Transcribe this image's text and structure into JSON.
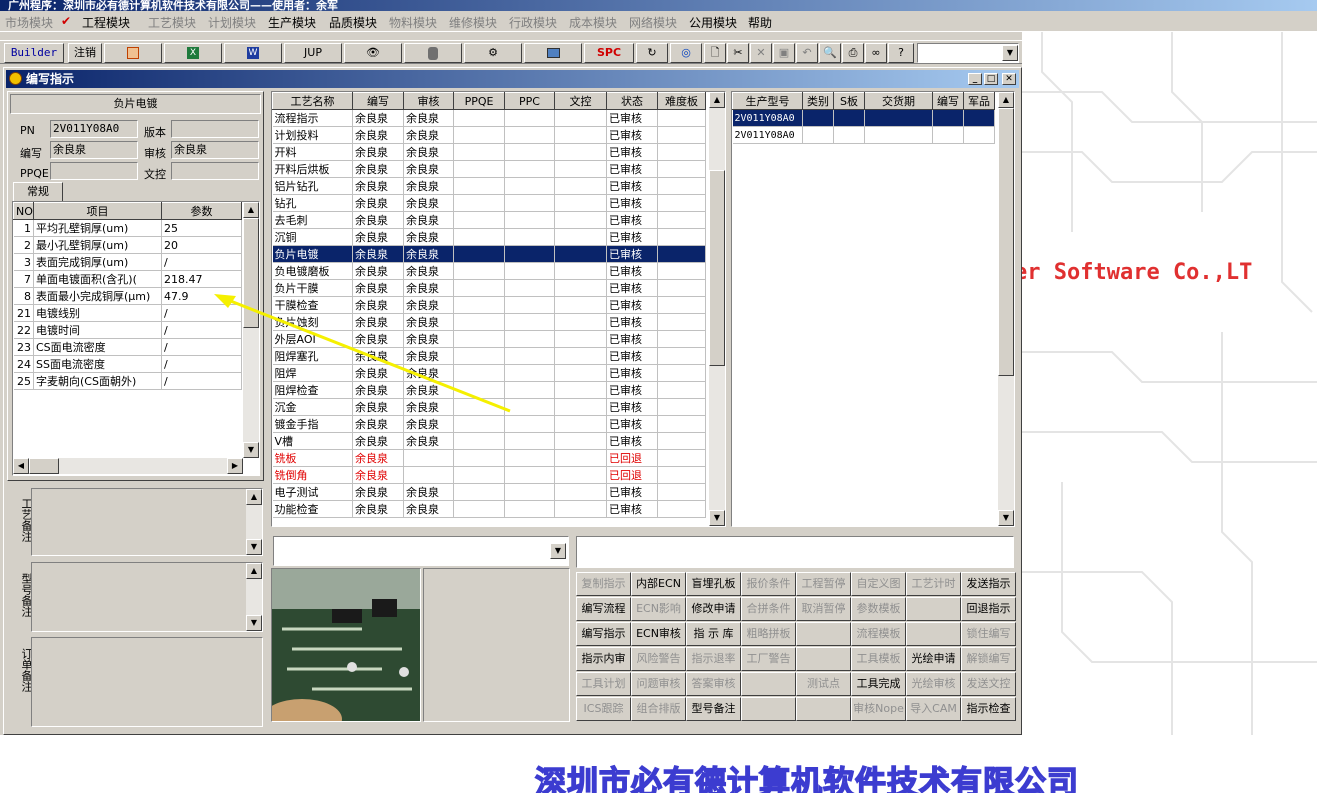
{
  "app_title": "广州程序：深圳市必有德计算机软件技术有限公司——使用者：余军",
  "menu": [
    {
      "label": "市场模块",
      "dim": true
    },
    {
      "label": "工程模块",
      "dim": false,
      "checked": true
    },
    {
      "label": "工艺模块",
      "dim": true
    },
    {
      "label": "计划模块",
      "dim": true
    },
    {
      "label": "生产模块",
      "dim": false
    },
    {
      "label": "品质模块",
      "dim": false
    },
    {
      "label": "物料模块",
      "dim": true
    },
    {
      "label": "维修模块",
      "dim": true
    },
    {
      "label": "行政模块",
      "dim": true
    },
    {
      "label": "成本模块",
      "dim": true
    },
    {
      "label": "网络模块",
      "dim": true
    },
    {
      "label": "公用模块",
      "dim": false
    },
    {
      "label": "帮助",
      "dim": false
    }
  ],
  "toolbar": {
    "builder": "Builder",
    "logout": "注销",
    "jup": "JUP",
    "spc": "SPC"
  },
  "desktop": {
    "watermark_right": "er Software Co.,LT",
    "watermark_bottom": "深圳市必有德计算机软件技术有限公司"
  },
  "window": {
    "title": "编写指示",
    "panel_title": "负片电镀",
    "pn_label": "PN",
    "pn_value": "2V011Y08A0",
    "version_label": "版本",
    "version_value": "",
    "writer_label": "编写",
    "writer_value": "余良泉",
    "review_label": "审核",
    "review_value": "余良泉",
    "ppqe_label": "PPQE",
    "ppqe_value": "",
    "wenkong_label": "文控",
    "wenkong_value": "",
    "tab_normal": "常规",
    "params": {
      "headers": [
        "NO",
        "项目",
        "参数"
      ],
      "rows": [
        [
          "1",
          "平均孔壁铜厚(um)",
          "25"
        ],
        [
          "2",
          "最小孔壁铜厚(um)",
          "20"
        ],
        [
          "3",
          "表面完成铜厚(um)",
          "/"
        ],
        [
          "7",
          "单面电镀面积(含孔)(",
          "218.47"
        ],
        [
          "8",
          "表面最小完成铜厚(μm)",
          "47.9"
        ],
        [
          "21",
          "电镀线别",
          "/"
        ],
        [
          "22",
          "电镀时间",
          "/"
        ],
        [
          "23",
          "CS面电流密度",
          "/"
        ],
        [
          "24",
          "SS面电流密度",
          "/"
        ],
        [
          "25",
          "字麦朝向(CS面朝外)",
          "/"
        ]
      ]
    },
    "notes": {
      "process": "工艺备注",
      "model": "型号备注",
      "order": "订单备注"
    },
    "process": {
      "headers": [
        "工艺名称",
        "编写",
        "审核",
        "PPQE",
        "PPC",
        "文控",
        "状态",
        "难度板"
      ],
      "rows": [
        {
          "name": "流程指示",
          "writer": "余良泉",
          "reviewer": "余良泉",
          "status": "已审核"
        },
        {
          "name": "计划投料",
          "writer": "余良泉",
          "reviewer": "余良泉",
          "status": "已审核"
        },
        {
          "name": "开料",
          "writer": "余良泉",
          "reviewer": "余良泉",
          "status": "已审核"
        },
        {
          "name": "开料后烘板",
          "writer": "余良泉",
          "reviewer": "余良泉",
          "status": "已审核"
        },
        {
          "name": "铝片钻孔",
          "writer": "余良泉",
          "reviewer": "余良泉",
          "status": "已审核"
        },
        {
          "name": "钻孔",
          "writer": "余良泉",
          "reviewer": "余良泉",
          "status": "已审核"
        },
        {
          "name": "去毛刺",
          "writer": "余良泉",
          "reviewer": "余良泉",
          "status": "已审核"
        },
        {
          "name": "沉铜",
          "writer": "余良泉",
          "reviewer": "余良泉",
          "status": "已审核"
        },
        {
          "name": "负片电镀",
          "writer": "余良泉",
          "reviewer": "余良泉",
          "status": "已审核",
          "sel": true
        },
        {
          "name": "负电镀磨板",
          "writer": "余良泉",
          "reviewer": "余良泉",
          "status": "已审核"
        },
        {
          "name": "负片干膜",
          "writer": "余良泉",
          "reviewer": "余良泉",
          "status": "已审核"
        },
        {
          "name": "干膜检查",
          "writer": "余良泉",
          "reviewer": "余良泉",
          "status": "已审核"
        },
        {
          "name": "负片蚀刻",
          "writer": "余良泉",
          "reviewer": "余良泉",
          "status": "已审核"
        },
        {
          "name": "外层AOI",
          "writer": "余良泉",
          "reviewer": "余良泉",
          "status": "已审核"
        },
        {
          "name": "阻焊塞孔",
          "writer": "余良泉",
          "reviewer": "余良泉",
          "status": "已审核"
        },
        {
          "name": "阻焊",
          "writer": "余良泉",
          "reviewer": "余良泉",
          "status": "已审核"
        },
        {
          "name": "阻焊检查",
          "writer": "余良泉",
          "reviewer": "余良泉",
          "status": "已审核"
        },
        {
          "name": "沉金",
          "writer": "余良泉",
          "reviewer": "余良泉",
          "status": "已审核"
        },
        {
          "name": "镀金手指",
          "writer": "余良泉",
          "reviewer": "余良泉",
          "status": "已审核"
        },
        {
          "name": "V槽",
          "writer": "余良泉",
          "reviewer": "余良泉",
          "status": "已审核"
        },
        {
          "name": "铣板",
          "writer": "余良泉",
          "reviewer": "",
          "status": "已回退",
          "red": true
        },
        {
          "name": "铣倒角",
          "writer": "余良泉",
          "reviewer": "",
          "status": "已回退",
          "red": true
        },
        {
          "name": "电子测试",
          "writer": "余良泉",
          "reviewer": "余良泉",
          "status": "已审核"
        },
        {
          "name": "功能检查",
          "writer": "余良泉",
          "reviewer": "余良泉",
          "status": "已审核"
        }
      ]
    },
    "models": {
      "headers": [
        "生产型号",
        "类别",
        "S板",
        "交货期",
        "编写",
        "军品"
      ],
      "rows": [
        [
          "2V011Y08A0",
          "",
          "",
          "",
          "",
          ""
        ],
        [
          "2V011Y08A0",
          "",
          "",
          "",
          "",
          ""
        ]
      ]
    },
    "actions": [
      [
        {
          "t": "复制指示",
          "e": false
        },
        {
          "t": "内部ECN",
          "e": true
        },
        {
          "t": "盲埋孔板",
          "e": true
        },
        {
          "t": "报价条件",
          "e": false
        },
        {
          "t": "工程暂停",
          "e": false
        },
        {
          "t": "自定义图",
          "e": false
        },
        {
          "t": "工艺计时",
          "e": false
        },
        {
          "t": "发送指示",
          "e": true
        }
      ],
      [
        {
          "t": "编写流程",
          "e": true
        },
        {
          "t": "ECN影响",
          "e": false
        },
        {
          "t": "修改申请",
          "e": true
        },
        {
          "t": "合拼条件",
          "e": false
        },
        {
          "t": "取消暂停",
          "e": false
        },
        {
          "t": "参数模板",
          "e": false
        },
        {
          "t": "",
          "e": false
        },
        {
          "t": "回退指示",
          "e": true
        }
      ],
      [
        {
          "t": "编写指示",
          "e": true
        },
        {
          "t": "ECN审核",
          "e": true
        },
        {
          "t": "指 示 库",
          "e": true
        },
        {
          "t": "粗略拼板",
          "e": false
        },
        {
          "t": "",
          "e": false
        },
        {
          "t": "流程模板",
          "e": false
        },
        {
          "t": "",
          "e": false
        },
        {
          "t": "锁住编写",
          "e": false
        }
      ],
      [
        {
          "t": "指示内审",
          "e": true
        },
        {
          "t": "风险警告",
          "e": false
        },
        {
          "t": "指示退率",
          "e": false
        },
        {
          "t": "工厂警告",
          "e": false
        },
        {
          "t": "",
          "e": false
        },
        {
          "t": "工具模板",
          "e": false
        },
        {
          "t": "光绘申请",
          "e": true
        },
        {
          "t": "解锁编写",
          "e": false
        }
      ],
      [
        {
          "t": "工具计划",
          "e": false
        },
        {
          "t": "问题审核",
          "e": false
        },
        {
          "t": "答案审核",
          "e": false
        },
        {
          "t": "",
          "e": false
        },
        {
          "t": "测试点",
          "e": false
        },
        {
          "t": "工具完成",
          "e": true
        },
        {
          "t": "光绘审核",
          "e": false
        },
        {
          "t": "发送文控",
          "e": false
        }
      ],
      [
        {
          "t": "ICS跟踪",
          "e": false
        },
        {
          "t": "组合排版",
          "e": false
        },
        {
          "t": "型号备注",
          "e": true
        },
        {
          "t": "",
          "e": false
        },
        {
          "t": "",
          "e": false
        },
        {
          "t": "审核Nope",
          "e": false
        },
        {
          "t": "导入CAM",
          "e": false
        },
        {
          "t": "指示检查",
          "e": true
        }
      ]
    ]
  }
}
